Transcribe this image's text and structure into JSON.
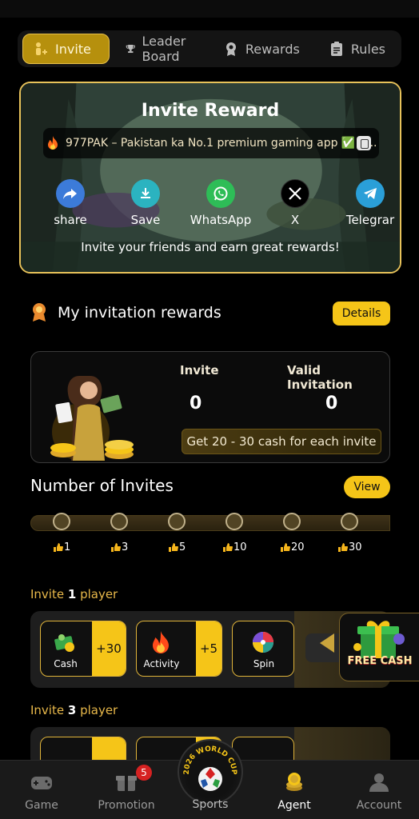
{
  "tabs": [
    {
      "label": "Invite",
      "icon": "invite-icon",
      "active": true
    },
    {
      "label": "Leader Board",
      "icon": "trophy-icon",
      "active": false
    },
    {
      "label": "Rewards",
      "icon": "medal-icon",
      "active": false
    },
    {
      "label": "Rules",
      "icon": "clipboard-icon",
      "active": false
    }
  ],
  "reward_card": {
    "title": "Invite Reward",
    "promo_text": "977PAK – Pakistan ka No.1 premium gaming app ✅ A...",
    "share_items": [
      {
        "label": "share",
        "icon": "share-icon",
        "color": "#3c7bd9"
      },
      {
        "label": "Save",
        "icon": "download-icon",
        "color": "#2bb3c0"
      },
      {
        "label": "WhatsApp",
        "icon": "whatsapp-icon",
        "color": "#2ebd57"
      },
      {
        "label": "X",
        "icon": "x-icon",
        "color": "#000000"
      },
      {
        "label": "Telegrar",
        "icon": "telegram-icon",
        "color": "#2a9fd8"
      }
    ],
    "subtitle": "Invite your friends and earn great rewards!"
  },
  "my_rewards": {
    "title": "My invitation rewards",
    "details_label": "Details",
    "invite_label": "Invite",
    "invite_value": "0",
    "valid_label": "Valid Invitation",
    "valid_value": "0",
    "cash_text": "Get 20 - 30 cash for each invite"
  },
  "invites": {
    "title": "Number of Invites",
    "view_label": "View",
    "steps": [
      "1",
      "3",
      "5",
      "10",
      "20",
      "30"
    ]
  },
  "tiers": [
    {
      "prefix": "Invite ",
      "count": "1",
      "suffix": " player",
      "items": [
        {
          "name": "Cash",
          "amount": "+30",
          "icon": "cash-icon"
        },
        {
          "name": "Activity",
          "amount": "+5",
          "icon": "flame-icon"
        },
        {
          "name": "Spin",
          "amount": "",
          "icon": "spin-wheel-icon"
        }
      ]
    },
    {
      "prefix": "Invite ",
      "count": "3",
      "suffix": " player",
      "items": []
    }
  ],
  "free_cash": {
    "text": "FREE CASH"
  },
  "bottom_nav": [
    {
      "label": "Game",
      "icon": "gamepad-icon",
      "active": false
    },
    {
      "label": "Promotion",
      "icon": "gift-icon",
      "active": false,
      "badge": "5"
    },
    {
      "label": "Sports",
      "icon": "world-cup-icon",
      "active": false
    },
    {
      "label": "Agent",
      "icon": "coins-icon",
      "active": true
    },
    {
      "label": "Account",
      "icon": "user-icon",
      "active": false
    }
  ],
  "sports_badge_text": "2026 WORLD CUP",
  "colors": {
    "accent": "#f5c518",
    "gold_border": "#e8c25a",
    "bg": "#000000"
  }
}
